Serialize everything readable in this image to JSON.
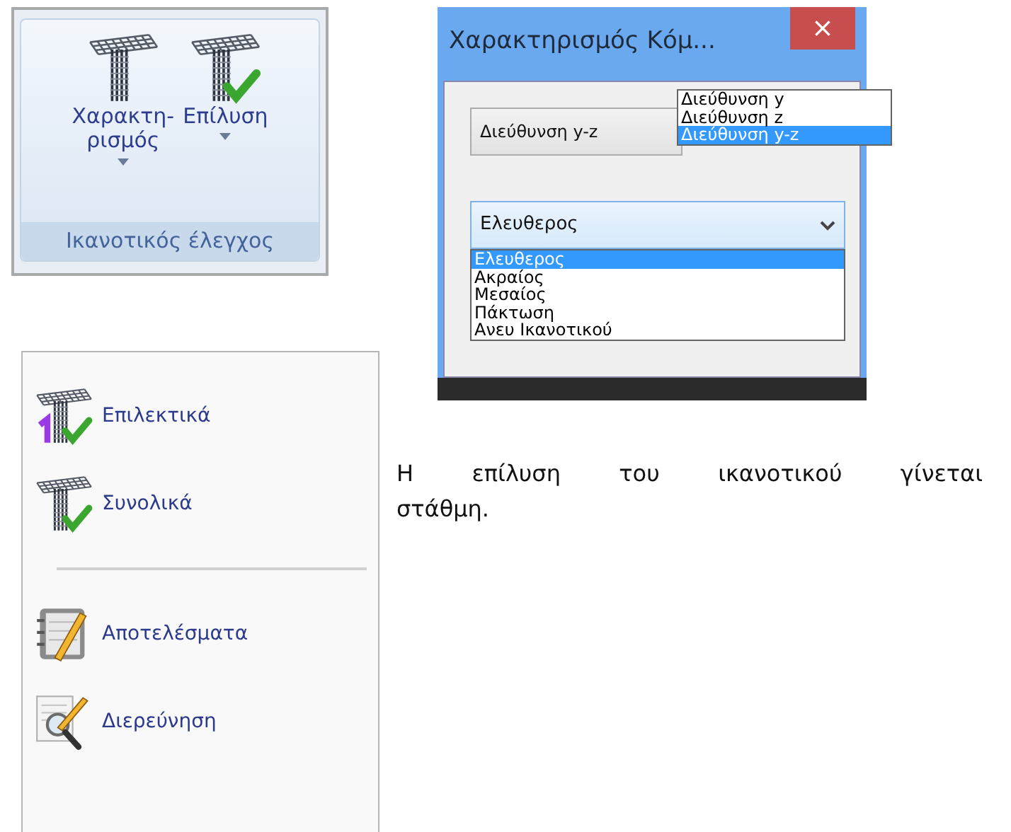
{
  "ribbon": {
    "buttons": [
      {
        "label": "Χαρακτη-\nρισμός",
        "dropdown": true
      },
      {
        "label": "Επίλυση",
        "dropdown": true
      }
    ],
    "group_label": "Ικανοτικός έλεγχος"
  },
  "dialog": {
    "title": "Χαρακτηρισμός Κόμ...",
    "close": "×",
    "direction_combo": {
      "value": "Διεύθυνση y-z",
      "expanded": true,
      "options": [
        {
          "label": "Διεύθυνση y",
          "selected": false
        },
        {
          "label": "Διεύθυνση z",
          "selected": false
        },
        {
          "label": "Διεύθυνση y-z",
          "selected": true
        }
      ]
    },
    "type_combo": {
      "value": "Ελευθερος",
      "expanded": true,
      "options": [
        {
          "label": "Ελευθερος",
          "selected": true
        },
        {
          "label": "Ακραίος",
          "selected": false
        },
        {
          "label": "Μεσαίος",
          "selected": false
        },
        {
          "label": "Πάκτωση",
          "selected": false
        },
        {
          "label": "Ανευ Ικανοτικού",
          "selected": false
        }
      ]
    }
  },
  "menu": {
    "items": [
      {
        "kind": "item",
        "label": "Επιλεκτικά"
      },
      {
        "kind": "item",
        "label": "Συνολικά"
      },
      {
        "kind": "divider"
      },
      {
        "kind": "item",
        "label": "Αποτελέσματα"
      },
      {
        "kind": "item",
        "label": "Διερεύνηση"
      }
    ]
  },
  "paragraph": {
    "lines": [
      "Η επίλυση του ικανοτικού γίνεται",
      "στάθμη."
    ]
  }
}
